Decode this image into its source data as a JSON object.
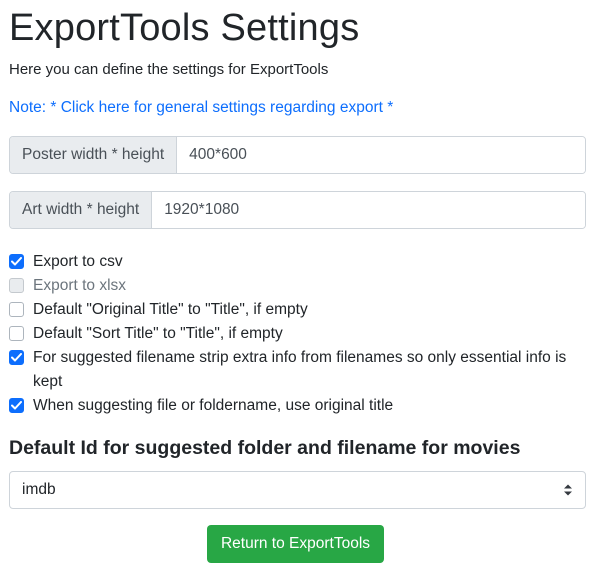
{
  "page": {
    "title": "ExportTools Settings",
    "subtitle": "Here you can define the settings for ExportTools",
    "note_link": "Note: * Click here for general settings regarding export *"
  },
  "fields": [
    {
      "label": "Poster width * height",
      "value": "400*600"
    },
    {
      "label": "Art width * height",
      "value": "1920*1080"
    }
  ],
  "checkboxes": [
    {
      "label": "Export to csv",
      "checked": true,
      "disabled": false
    },
    {
      "label": "Export to xlsx",
      "checked": false,
      "disabled": true
    },
    {
      "label": "Default \"Original Title\" to \"Title\", if empty",
      "checked": false,
      "disabled": false
    },
    {
      "label": "Default \"Sort Title\" to \"Title\", if empty",
      "checked": false,
      "disabled": false
    },
    {
      "label": "For suggested filename strip extra info from filenames so only essential info is kept",
      "checked": true,
      "disabled": false
    },
    {
      "label": "When suggesting file or foldername, use original title",
      "checked": true,
      "disabled": false
    }
  ],
  "default_id": {
    "heading": "Default Id for suggested folder and filename for movies",
    "selected": "imdb"
  },
  "return_button": "Return to ExportTools",
  "colors": {
    "link": "#0d6efd",
    "checkbox_checked": "#0d6efd",
    "button": "#28a745",
    "addon_bg": "#e9ecef"
  }
}
